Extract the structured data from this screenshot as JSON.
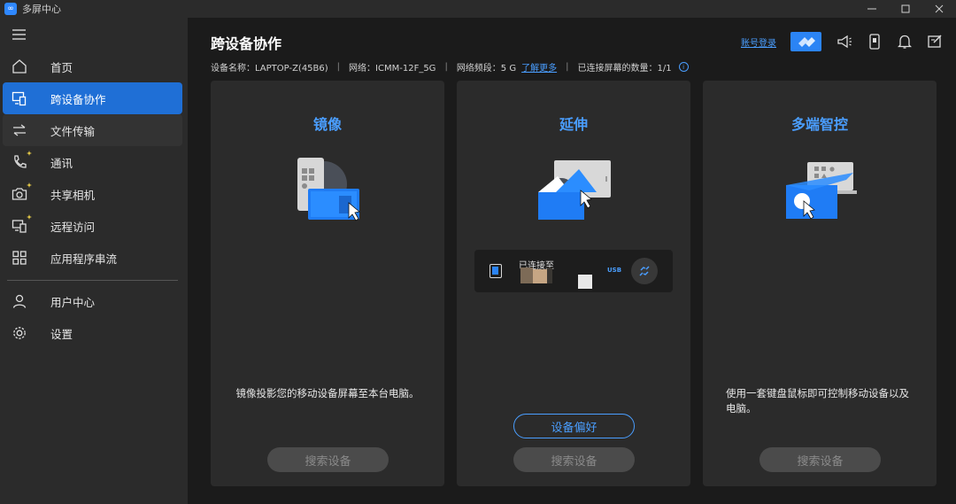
{
  "app": {
    "title": "多屏中心",
    "logo_text": "∞"
  },
  "window_controls": [
    "minimize",
    "maximize",
    "close"
  ],
  "sidebar": {
    "items": [
      {
        "label": "首页",
        "icon": "home-icon"
      },
      {
        "label": "跨设备协作",
        "icon": "cross-device-icon",
        "active": true
      },
      {
        "label": "文件传输",
        "icon": "transfer-arrows-icon"
      },
      {
        "label": "通讯",
        "icon": "phone-icon"
      },
      {
        "label": "共享相机",
        "icon": "camera-icon"
      },
      {
        "label": "远程访问",
        "icon": "remote-access-icon"
      },
      {
        "label": "应用程序串流",
        "icon": "apps-grid-icon"
      },
      {
        "label": "用户中心",
        "icon": "user-icon"
      },
      {
        "label": "设置",
        "icon": "gear-icon"
      }
    ]
  },
  "header": {
    "title": "跨设备协作",
    "login_link": "账号登录",
    "info": {
      "device_name": "设备名称：LAPTOP-Z(45B6)",
      "network": "网络：ICMM-12F_5G",
      "band": "网络频段：5 G",
      "learn_more": "了解更多",
      "connected": "已连接屏幕的数量：1/1",
      "info_mark": "i"
    }
  },
  "cards": {
    "mirror": {
      "title": "镜像",
      "desc": "镜像投影您的移动设备屏幕至本台电脑。",
      "search_button": "搜索设备"
    },
    "extend": {
      "title": "延伸",
      "connected_label": "已连接至",
      "usb_label": "USB",
      "preference_button": "设备偏好",
      "search_button": "搜索设备"
    },
    "multi_control": {
      "title": "多端智控",
      "desc": "使用一套键盘鼠标即可控制移动设备以及电脑。",
      "search_button": "搜索设备"
    }
  },
  "colors": {
    "accent": "#2b84f5",
    "link": "#4a9eff",
    "active_nav": "#1f6fd6",
    "panel": "#2b2b2b",
    "background": "#1b1b1b"
  }
}
